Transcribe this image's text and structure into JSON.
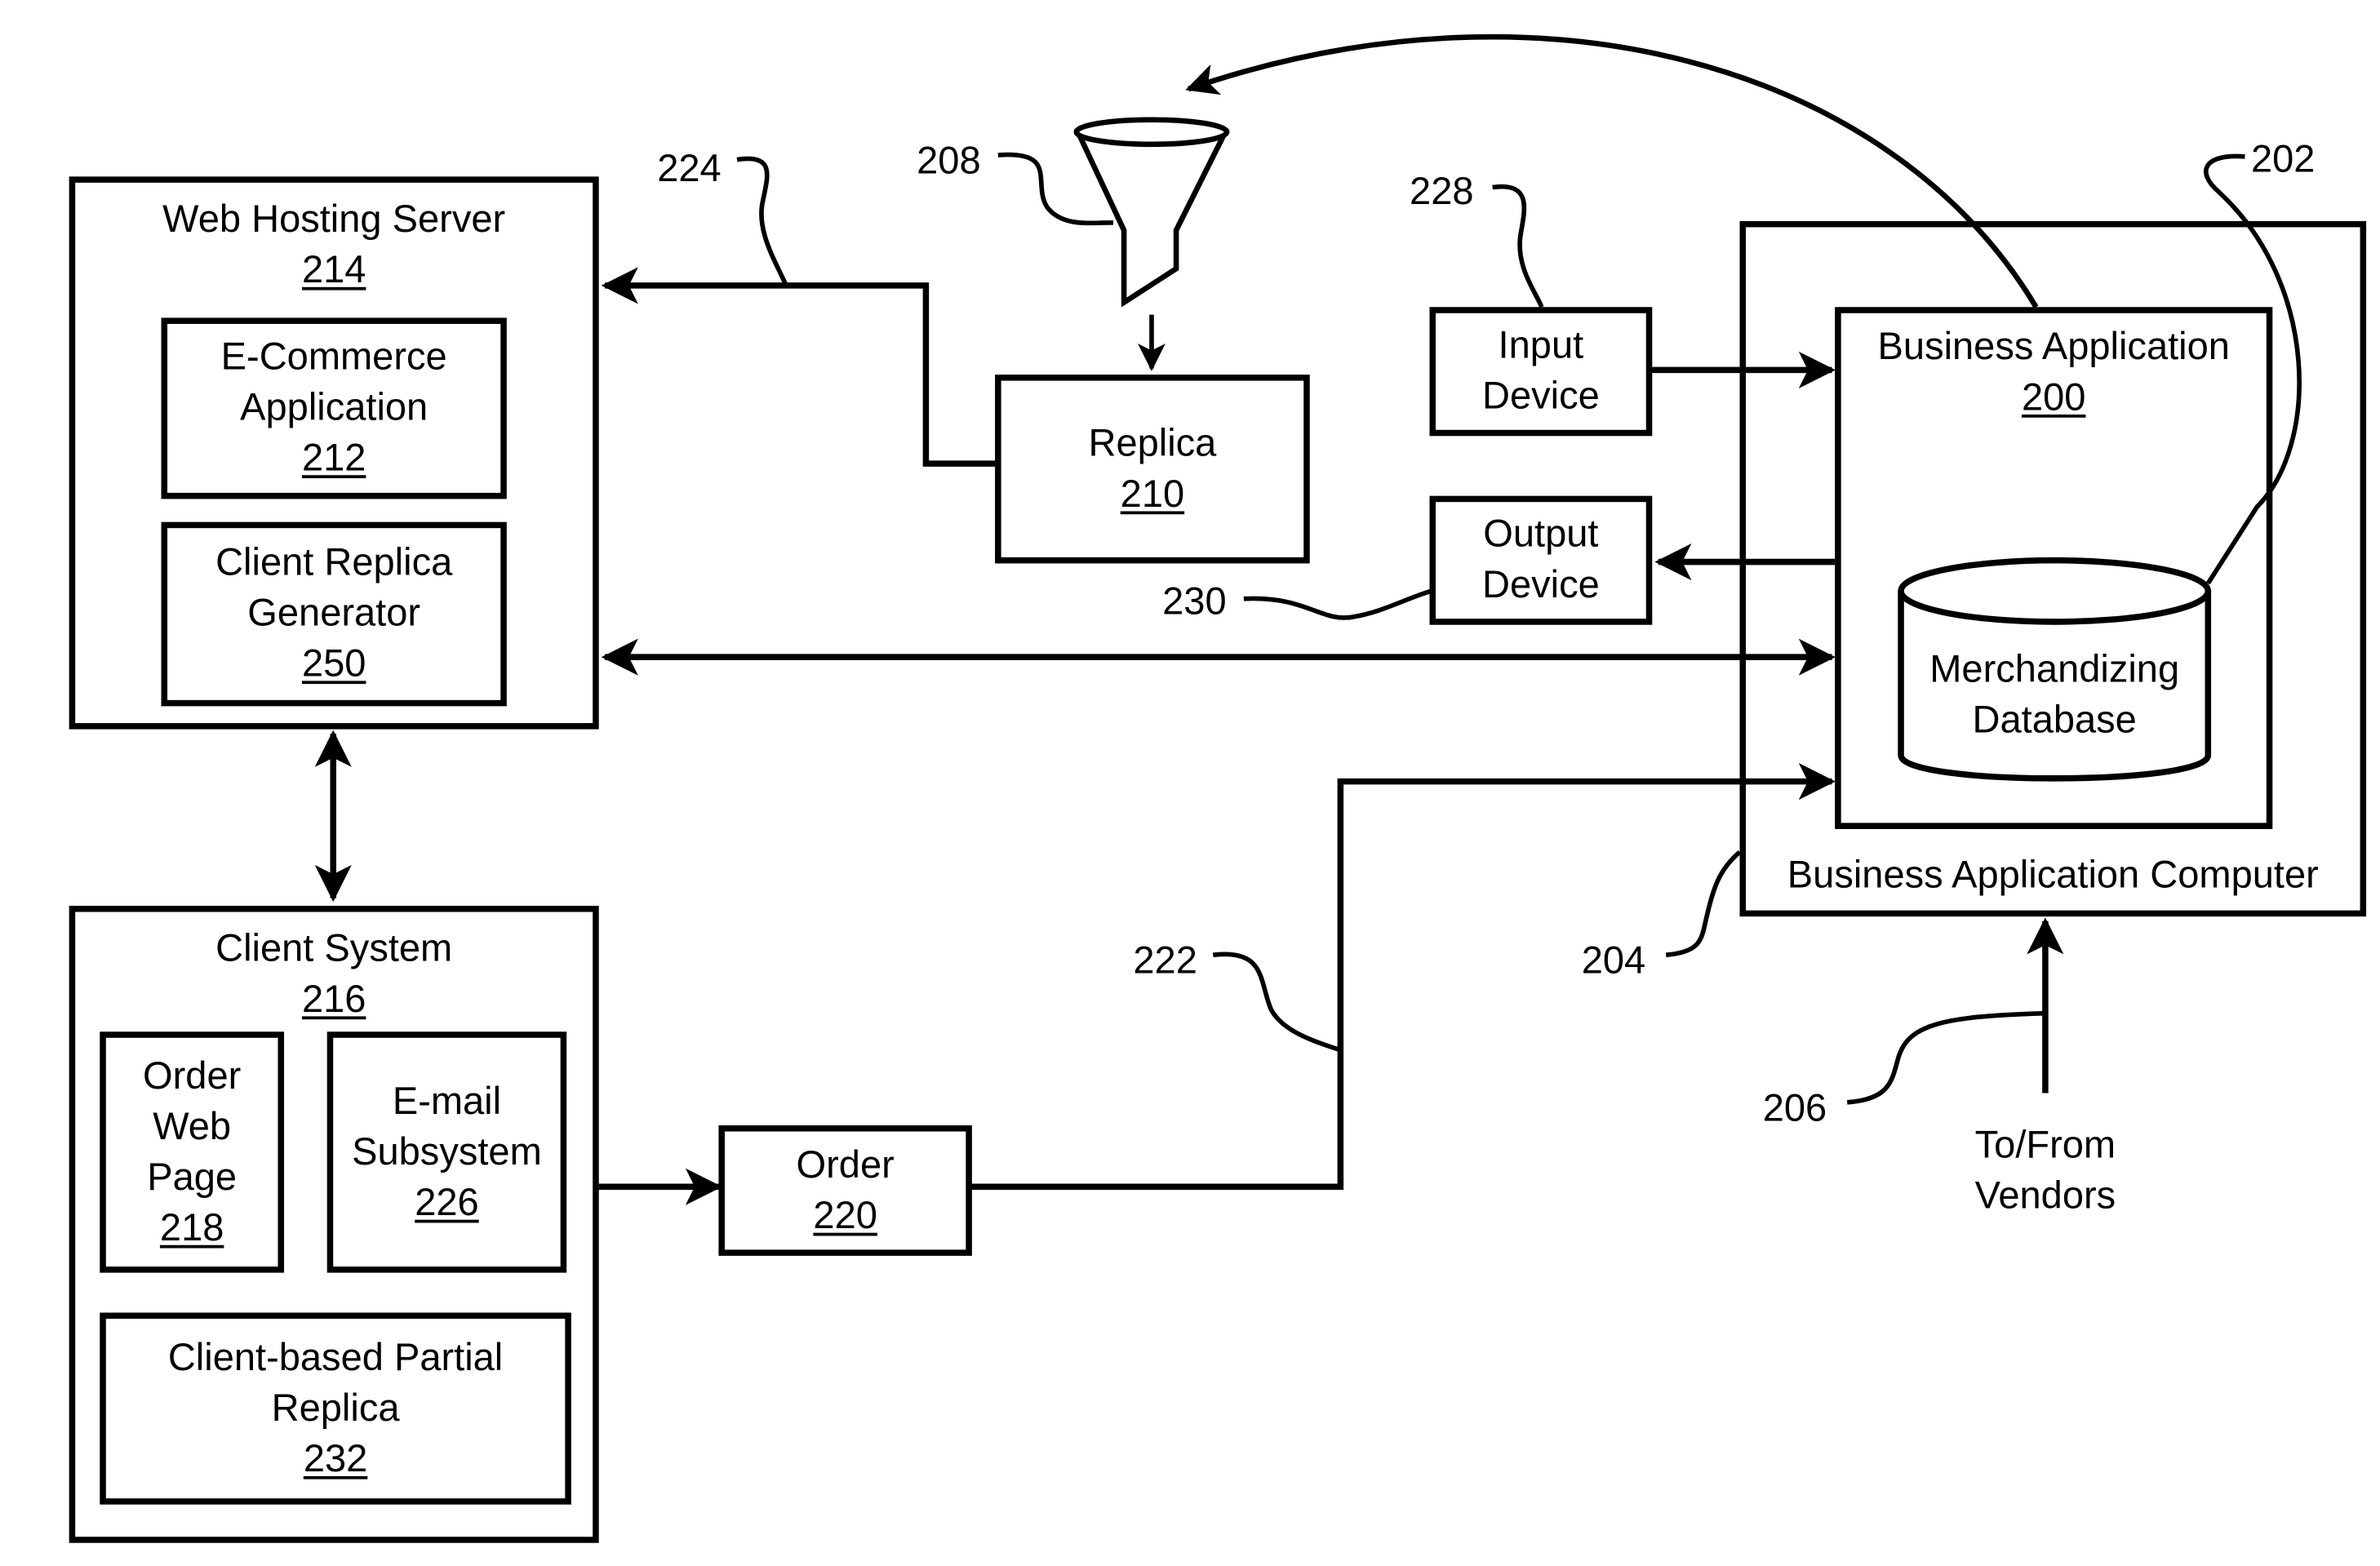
{
  "diagram": {
    "web_hosting_server": {
      "title": "Web Hosting Server",
      "number": "214"
    },
    "ecommerce_app": {
      "title_line1": "E-Commerce",
      "title_line2": "Application",
      "number": "212"
    },
    "client_replica_generator": {
      "title_line1": "Client Replica",
      "title_line2": "Generator",
      "number": "250"
    },
    "replica": {
      "title": "Replica",
      "number": "210"
    },
    "input_device": {
      "title_line1": "Input",
      "title_line2": "Device"
    },
    "output_device": {
      "title_line1": "Output",
      "title_line2": "Device"
    },
    "business_application": {
      "title": "Business Application",
      "number": "200"
    },
    "merchandizing_database": {
      "title_line1": "Merchandizing",
      "title_line2": "Database"
    },
    "business_application_computer": {
      "title": "Business Application Computer"
    },
    "client_system": {
      "title": "Client System",
      "number": "216"
    },
    "order_web_page": {
      "title_line1": "Order",
      "title_line2": "Web",
      "title_line3": "Page",
      "number": "218"
    },
    "email_subsystem": {
      "title_line1": "E-mail",
      "title_line2": "Subsystem",
      "number": "226"
    },
    "client_partial_replica": {
      "title_line1": "Client-based Partial",
      "title_line2": "Replica",
      "number": "232"
    },
    "order": {
      "title": "Order",
      "number": "220"
    },
    "vendors": {
      "title_line1": "To/From",
      "title_line2": "Vendors"
    },
    "reference_numerals": {
      "r202": "202",
      "r204": "204",
      "r206": "206",
      "r208": "208",
      "r222": "222",
      "r224": "224",
      "r228": "228",
      "r230": "230"
    },
    "icons": {
      "filter": "funnel-icon",
      "database": "cylinder-database-icon"
    }
  }
}
